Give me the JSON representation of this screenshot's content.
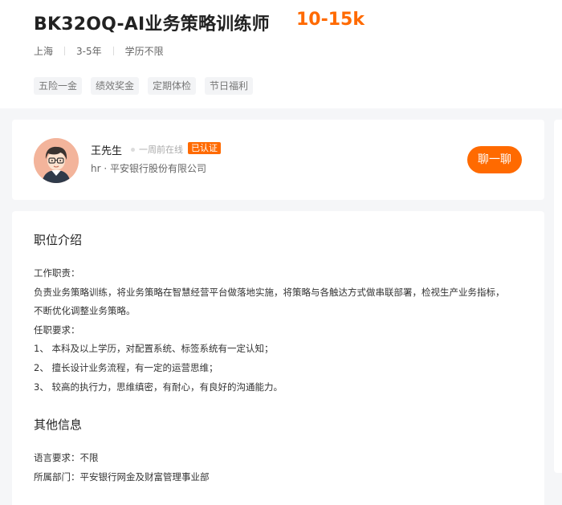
{
  "job": {
    "title": "BK32OQ-AI业务策略训练师",
    "salary": "10-15k",
    "meta": [
      "上海",
      "3-5年",
      "学历不限"
    ],
    "tags": [
      "五险一金",
      "绩效奖金",
      "定期体检",
      "节日福利"
    ]
  },
  "hr": {
    "name": "王先生",
    "online_status": "一周前在线",
    "verified_badge": "已认证",
    "company": "hr · 平安银行股份有限公司",
    "chat_button": "聊一聊"
  },
  "description": {
    "title": "职位介绍",
    "lines": [
      "工作职责：",
      "负责业务策略训练，将业务策略在智慧经营平台做落地实施，将策略与各触达方式做串联部署，检视生产业务指标，",
      "不断优化调整业务策略。",
      "任职要求：",
      "1、 本科及以上学历，对配置系统、标签系统有一定认知；",
      "2、 擅长设计业务流程，有一定的运营思维；",
      "3、 较高的执行力，思维缜密，有耐心，有良好的沟通能力。"
    ]
  },
  "other_info": {
    "title": "其他信息",
    "lines": [
      "语言要求：不限",
      "所属部门：平安银行网金及财富管理事业部"
    ]
  },
  "colors": {
    "accent": "#ff6a00",
    "page_bg": "#f5f6f8"
  },
  "icons": [
    "avatar-illustration",
    "online-dot"
  ]
}
